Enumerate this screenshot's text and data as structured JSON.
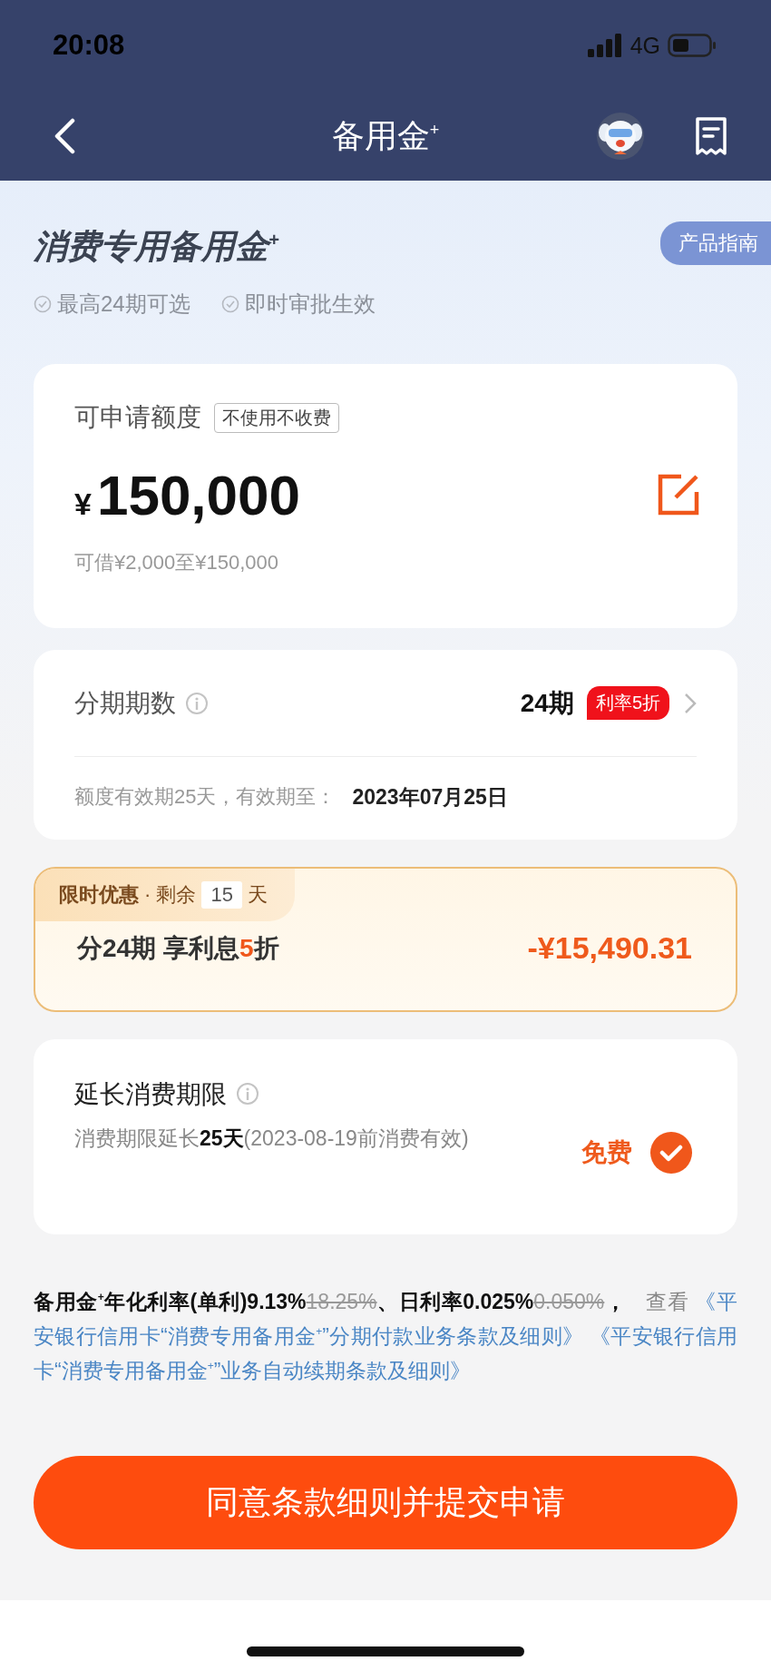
{
  "status_bar": {
    "time": "20:08",
    "network": "4G"
  },
  "nav": {
    "title": "备用金$^{+}$"
  },
  "hero": {
    "title": "消费专用备用金$^{+}$",
    "guide_button": "产品指南",
    "features": [
      "最高24期可选",
      "即时审批生效"
    ]
  },
  "quota_card": {
    "label": "可申请额度",
    "tag": "不使用不收费",
    "currency": "¥",
    "amount": "150,000",
    "range": "可借¥2,000至¥150,000"
  },
  "installment_card": {
    "label": "分期期数",
    "value": "24期",
    "badge": "利率5折",
    "validity_label": "额度有效期25天，有效期至：",
    "validity_date": "2023年07月25日"
  },
  "promo_card": {
    "tag": "限时优惠",
    "remaining_label": "· 剩余",
    "days": "15",
    "days_unit": "天",
    "title_parts": [
      {
        "text": "分24期 享利息",
        "highlight": false
      },
      {
        "text": "5",
        "highlight": true
      },
      {
        "text": "折",
        "highlight": false
      }
    ],
    "saving": "-¥15,490.31"
  },
  "extension_card": {
    "title": "延长消费期限",
    "description": "消费期限延长**25天**(2023-08-19前消费有效)",
    "price": "免费",
    "checked": true
  },
  "terms": [
    {
      "kind": "text",
      "text": "备用金$^{+}$年化利率(单利)9.13%"
    },
    {
      "kind": "struck",
      "text": "18.25%"
    },
    {
      "kind": "text",
      "text": "、日利率0.025%"
    },
    {
      "kind": "struck",
      "text": "0.050%"
    },
    {
      "kind": "text",
      "text": "，"
    },
    {
      "kind": "muted",
      "text": "查看"
    },
    {
      "kind": "link",
      "text": "《平安银行信用卡“消费专用备用金$^{+}$”分期付款业务条款及细则》"
    },
    {
      "kind": "link",
      "text": "《平安银行信用卡“消费专用备用金$^{+}$”业务自动续期条款及细则》"
    }
  ],
  "submit_button": "同意条款细则并提交申请"
}
